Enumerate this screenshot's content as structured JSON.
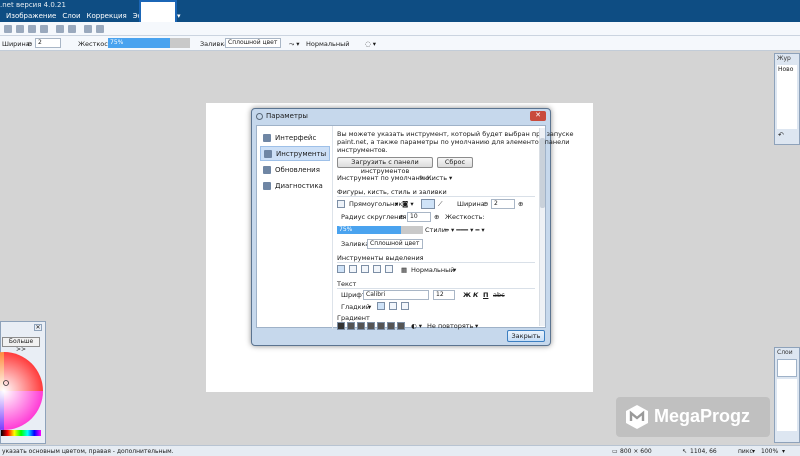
{
  "app": {
    "title": ".net версия 4.0.21"
  },
  "menu": [
    "Изображение",
    "Слои",
    "Коррекция",
    "Эффекты"
  ],
  "toolbar": {
    "width_label": "Ширина:",
    "width_value": "2",
    "hardness_label": "Жесткость:",
    "hardness_value": "75%",
    "fill_label": "Заливка:",
    "fill_value": "Сплошной цвет",
    "blend_value": "Нормальный"
  },
  "dialog": {
    "title": "Параметры",
    "close_label": "✕",
    "nav": [
      "Интерфейс",
      "Инструменты",
      "Обновления",
      "Диагностика"
    ],
    "intro": "Вы можете указать инструмент, который будет выбран при запуске",
    "intro2": "paint.net, а также параметры по умолчанию для элементов панели",
    "intro3": "инструментов.",
    "load_button": "Загрузить с панели инструментов",
    "reset_button": "Сброс",
    "default_tool_label": "Инструмент по умолчанию:",
    "default_tool_value": "Кисть",
    "section_shapes": "Фигуры, кисть, стиль и заливки",
    "shape_value": "Прямоугольник",
    "width_label": "Ширина:",
    "width_value": "2",
    "radius_label": "Радиус скругления:",
    "radius_value": "10",
    "hardness_label": "Жесткость:",
    "hardness_value": "75%",
    "styles_label": "Стили:",
    "fill_label": "Заливка:",
    "fill_value": "Сплошной цвет",
    "section_selection": "Инструменты выделения",
    "selection_mode": "Нормальный",
    "section_text": "Текст",
    "font_label": "Шрифт:",
    "font_value": "Calibri",
    "font_size": "12",
    "bold": "Ж",
    "italic": "К",
    "underline": "П",
    "strike": "abc",
    "smooth_value": "Гладкий",
    "section_gradient": "Градиент",
    "gradient_repeat": "Не повторять",
    "close_button": "Закрыть"
  },
  "palette": {
    "more_button": "Больше >>"
  },
  "history": {
    "item": "Ново"
  },
  "layers": {
    "title": "Слои"
  },
  "statusbar": {
    "hint": "указать основным цветом, правая - дополнительным.",
    "size": "800 × 600",
    "coords": "1104, 66",
    "unit": "пикс",
    "zoom": "100%"
  },
  "watermark": {
    "text": "MegaProgz"
  },
  "colors": {
    "titlebar": "#0e4d83",
    "accent": "#4aa3ef"
  }
}
